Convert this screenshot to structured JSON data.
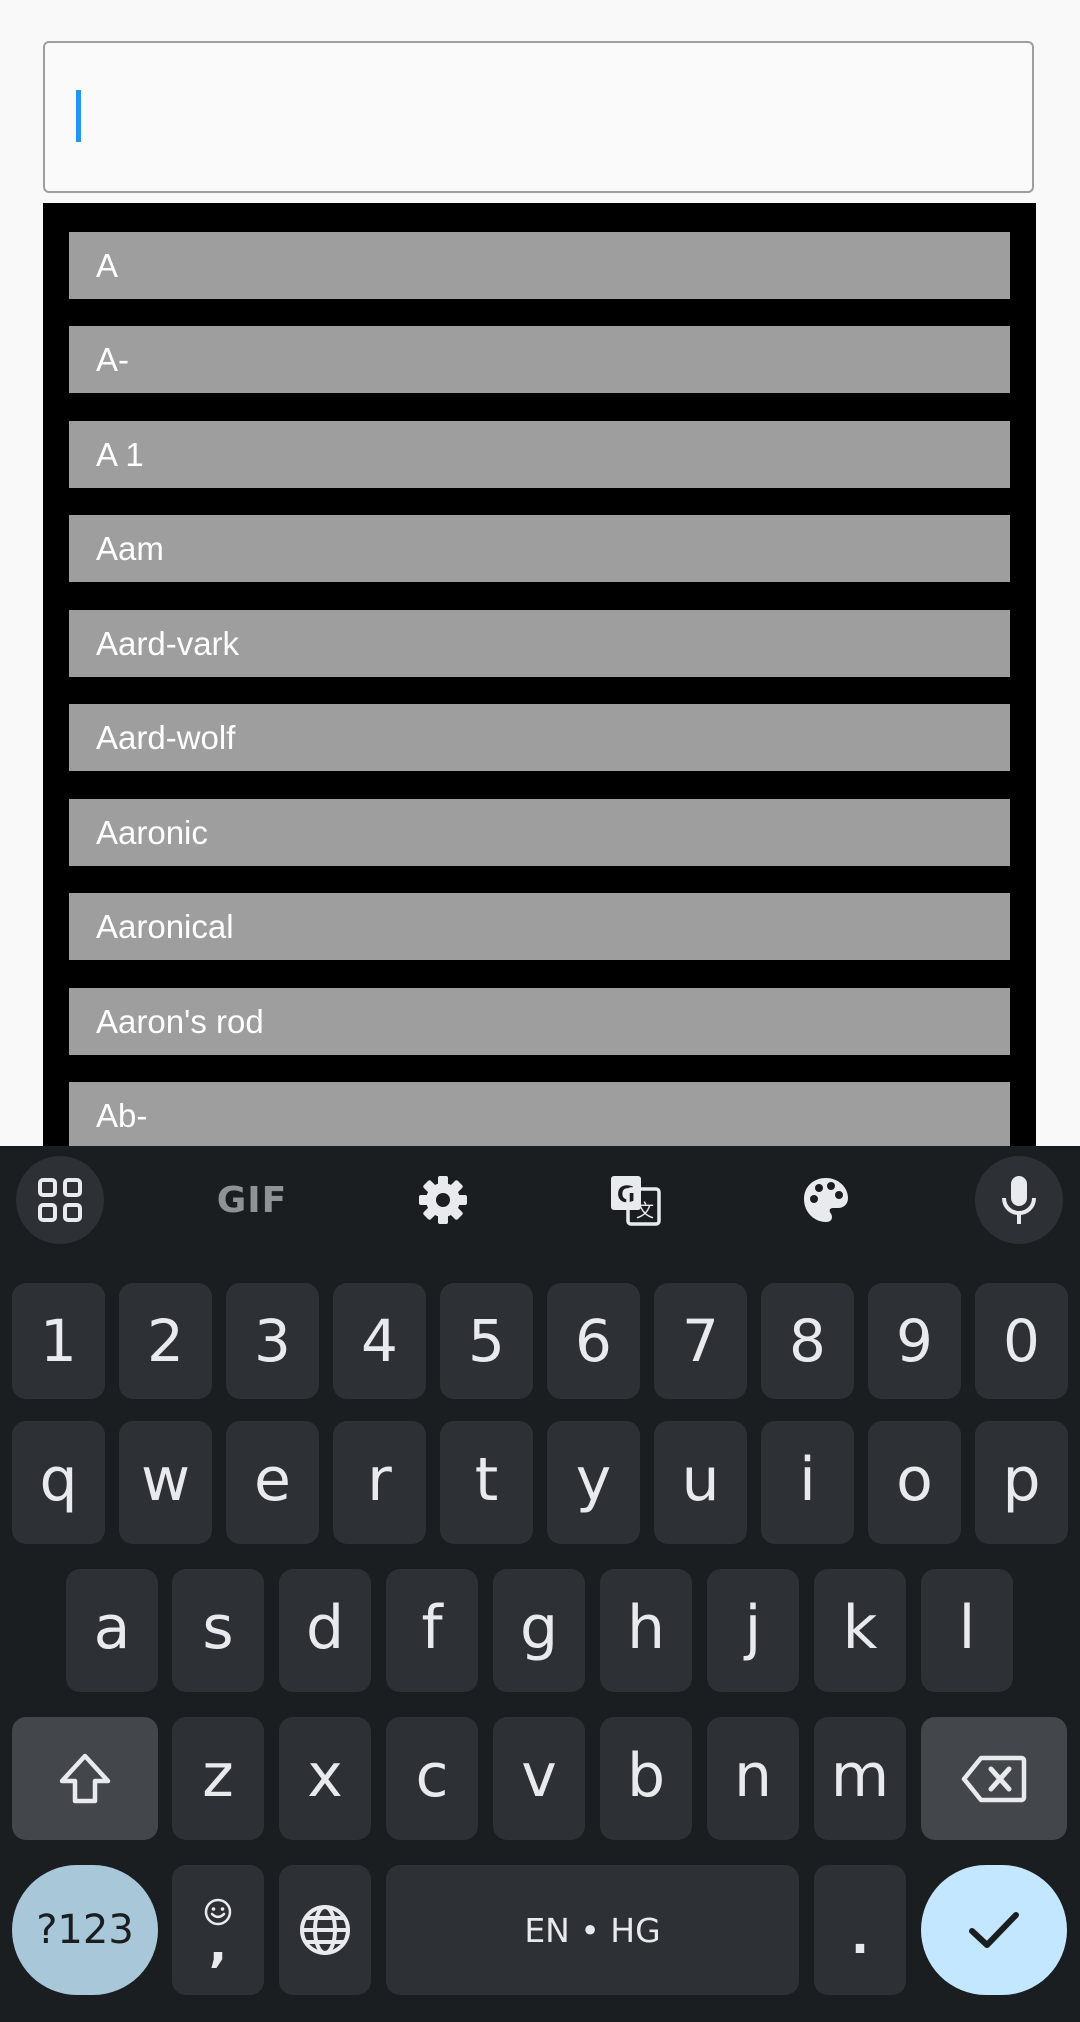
{
  "search": {
    "value": "",
    "placeholder": ""
  },
  "results": [
    "A",
    "A-",
    "A 1",
    "Aam",
    "Aard-vark",
    "Aard-wolf",
    "Aaronic",
    "Aaronical",
    "Aaron's rod",
    "Ab-"
  ],
  "keyboard": {
    "toolbar": {
      "gif_label": "GIF",
      "icons": [
        "apps-grid-icon",
        "gif-icon",
        "gear-icon",
        "translate-icon",
        "palette-icon",
        "microphone-icon"
      ]
    },
    "number_row": [
      "1",
      "2",
      "3",
      "4",
      "5",
      "6",
      "7",
      "8",
      "9",
      "0"
    ],
    "row1": [
      "q",
      "w",
      "e",
      "r",
      "t",
      "y",
      "u",
      "i",
      "o",
      "p"
    ],
    "row2": [
      "a",
      "s",
      "d",
      "f",
      "g",
      "h",
      "j",
      "k",
      "l"
    ],
    "row3": [
      "z",
      "x",
      "c",
      "v",
      "b",
      "n",
      "m"
    ],
    "symbols_label": "?123",
    "comma_label": ",",
    "space_label": "EN • HG",
    "period_label": ".",
    "colors": {
      "background": "#1b1e21",
      "key": "#2d3034",
      "function_key": "#43474c",
      "accent_key": "#c2e7ff",
      "symbols_key": "#a8c7d9"
    }
  },
  "colors": {
    "caret": "#2196f3",
    "list_background": "#000000",
    "list_item": "#9e9e9e"
  }
}
